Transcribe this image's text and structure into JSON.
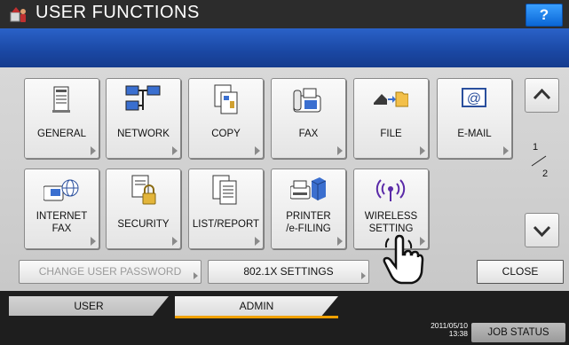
{
  "header": {
    "title": "USER FUNCTIONS",
    "help_label": "?"
  },
  "grid": {
    "general": "GENERAL",
    "network": "NETWORK",
    "copy": "COPY",
    "fax": "FAX",
    "file": "FILE",
    "email": "E-MAIL",
    "internet_fax": "INTERNET\nFAX",
    "security": "SECURITY",
    "list_report": "LIST/REPORT",
    "printer_efiling": "PRINTER\n/e-FILING",
    "wireless_setting": "WIRELESS\nSETTING"
  },
  "pager": {
    "current": "1",
    "total": "2"
  },
  "bottom_buttons": {
    "change_password": "CHANGE USER PASSWORD",
    "dot1x": "802.1X SETTINGS",
    "close": "CLOSE"
  },
  "tabs": {
    "user": "USER",
    "admin": "ADMIN"
  },
  "status": {
    "date": "2011/05/10",
    "time": "13:38",
    "job_status": "JOB STATUS"
  },
  "colors": {
    "accent_blue": "#1a47a3",
    "tab_underline": "#f0a000"
  }
}
